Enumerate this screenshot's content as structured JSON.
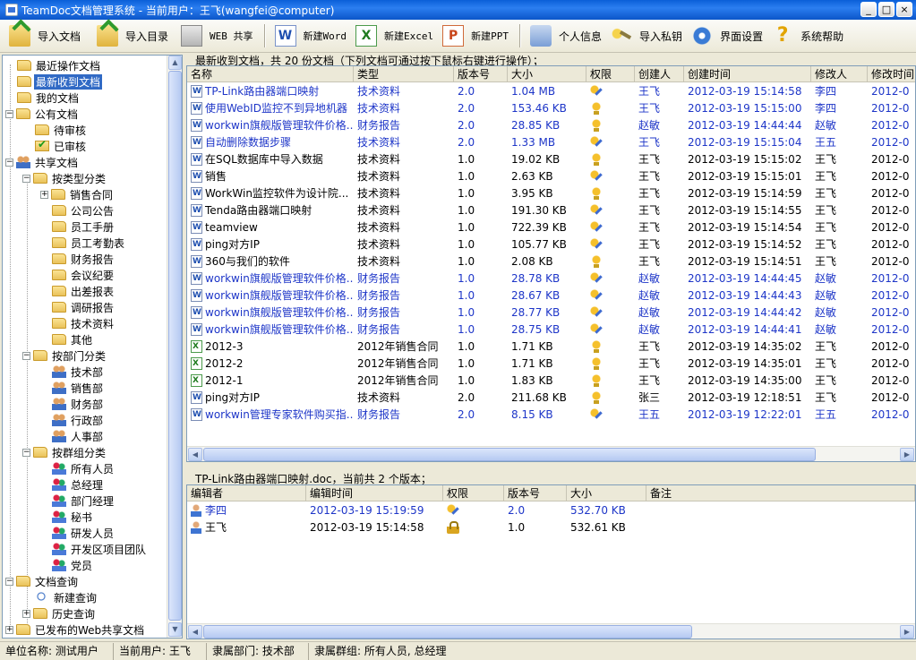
{
  "window": {
    "title": "TeamDoc文档管理系统 - 当前用户：王飞(wangfei@computer)",
    "buttons": [
      "_",
      "□",
      "×"
    ]
  },
  "toolbar": {
    "import_doc": "导入文档",
    "import_dir": "导入目录",
    "web_share": "WEB 共享",
    "new_word": "新建Word",
    "new_excel": "新建Excel",
    "new_ppt": "新建PPT",
    "personal_info": "个人信息",
    "import_key": "导入私钥",
    "ui_settings": "界面设置",
    "help": "系统帮助",
    "icons": {
      "import_doc": "import-folder-icon",
      "word": "word-icon",
      "excel": "excel-icon",
      "ppt": "ppt-icon"
    }
  },
  "tree": {
    "recent_ops": "最近操作文档",
    "recent_received": "最新收到文档",
    "my_docs": "我的文档",
    "public_docs": "公有文档",
    "pending_review": "待审核",
    "reviewed": "已审核",
    "shared_docs": "共享文档",
    "by_type": "按类型分类",
    "types": [
      "销售合同",
      "公司公告",
      "员工手册",
      "员工考勤表",
      "财务报告",
      "会议纪要",
      "出差报表",
      "调研报告",
      "技术资料",
      "其他"
    ],
    "by_dept": "按部门分类",
    "depts": [
      "技术部",
      "销售部",
      "财务部",
      "行政部",
      "人事部"
    ],
    "by_group": "按群组分类",
    "groups": [
      "所有人员",
      "总经理",
      "部门经理",
      "秘书",
      "研发人员",
      "开发区项目团队",
      "党员"
    ],
    "doc_query": "文档查询",
    "new_query": "新建查询",
    "history_query": "历史查询",
    "published_web": "已发布的Web共享文档"
  },
  "docs_panel": {
    "caption": "最新收到文档，共 20 份文档（下列文档可通过按下鼠标右键进行操作）；",
    "columns": [
      "名称",
      "类型",
      "版本号",
      "大小",
      "权限",
      "创建人",
      "创建时间",
      "修改人",
      "修改时间"
    ],
    "rows": [
      {
        "name": "TP-Link路由器端口映射",
        "type": "技术资料",
        "version": "2.0",
        "size": "1.04 MB",
        "perm": "edit",
        "creator": "王飞",
        "created": "2012-03-19 15:14:58",
        "modifier": "李四",
        "modified": "2012-0",
        "blue": true,
        "icon": "doc"
      },
      {
        "name": "使用WebID监控不到异地机器",
        "type": "技术资料",
        "version": "2.0",
        "size": "153.46 KB",
        "perm": "view",
        "creator": "王飞",
        "created": "2012-03-19 15:15:00",
        "modifier": "李四",
        "modified": "2012-0",
        "blue": true,
        "icon": "doc"
      },
      {
        "name": "workwin旗舰版管理软件价格...",
        "type": "财务报告",
        "version": "2.0",
        "size": "28.85 KB",
        "perm": "view",
        "creator": "赵敏",
        "created": "2012-03-19 14:44:44",
        "modifier": "赵敏",
        "modified": "2012-0",
        "blue": true,
        "icon": "doc"
      },
      {
        "name": "自动删除数据步骤",
        "type": "技术资料",
        "version": "2.0",
        "size": "1.33 MB",
        "perm": "edit",
        "creator": "王飞",
        "created": "2012-03-19 15:15:04",
        "modifier": "王五",
        "modified": "2012-0",
        "blue": true,
        "icon": "doc"
      },
      {
        "name": "在SQL数据库中导入数据",
        "type": "技术资料",
        "version": "1.0",
        "size": "19.02 KB",
        "perm": "view",
        "creator": "王飞",
        "created": "2012-03-19 15:15:02",
        "modifier": "王飞",
        "modified": "2012-0",
        "blue": false,
        "icon": "doc"
      },
      {
        "name": "销售",
        "type": "技术资料",
        "version": "1.0",
        "size": "2.63 KB",
        "perm": "edit",
        "creator": "王飞",
        "created": "2012-03-19 15:15:01",
        "modifier": "王飞",
        "modified": "2012-0",
        "blue": false,
        "icon": "doc"
      },
      {
        "name": "WorkWin监控软件为设计院...",
        "type": "技术资料",
        "version": "1.0",
        "size": "3.95 KB",
        "perm": "view",
        "creator": "王飞",
        "created": "2012-03-19 15:14:59",
        "modifier": "王飞",
        "modified": "2012-0",
        "blue": false,
        "icon": "doc"
      },
      {
        "name": "Tenda路由器端口映射",
        "type": "技术资料",
        "version": "1.0",
        "size": "191.30 KB",
        "perm": "edit",
        "creator": "王飞",
        "created": "2012-03-19 15:14:55",
        "modifier": "王飞",
        "modified": "2012-0",
        "blue": false,
        "icon": "doc"
      },
      {
        "name": "teamview",
        "type": "技术资料",
        "version": "1.0",
        "size": "722.39 KB",
        "perm": "edit",
        "creator": "王飞",
        "created": "2012-03-19 15:14:54",
        "modifier": "王飞",
        "modified": "2012-0",
        "blue": false,
        "icon": "doc"
      },
      {
        "name": "ping对方IP",
        "type": "技术资料",
        "version": "1.0",
        "size": "105.77 KB",
        "perm": "edit",
        "creator": "王飞",
        "created": "2012-03-19 15:14:52",
        "modifier": "王飞",
        "modified": "2012-0",
        "blue": false,
        "icon": "doc"
      },
      {
        "name": "360与我们的软件",
        "type": "技术资料",
        "version": "1.0",
        "size": "2.08 KB",
        "perm": "view",
        "creator": "王飞",
        "created": "2012-03-19 15:14:51",
        "modifier": "王飞",
        "modified": "2012-0",
        "blue": false,
        "icon": "doc"
      },
      {
        "name": "workwin旗舰版管理软件价格...",
        "type": "财务报告",
        "version": "1.0",
        "size": "28.78 KB",
        "perm": "edit",
        "creator": "赵敏",
        "created": "2012-03-19 14:44:45",
        "modifier": "赵敏",
        "modified": "2012-0",
        "blue": true,
        "icon": "doc"
      },
      {
        "name": "workwin旗舰版管理软件价格...",
        "type": "财务报告",
        "version": "1.0",
        "size": "28.67 KB",
        "perm": "edit",
        "creator": "赵敏",
        "created": "2012-03-19 14:44:43",
        "modifier": "赵敏",
        "modified": "2012-0",
        "blue": true,
        "icon": "doc"
      },
      {
        "name": "workwin旗舰版管理软件价格...",
        "type": "财务报告",
        "version": "1.0",
        "size": "28.77 KB",
        "perm": "edit",
        "creator": "赵敏",
        "created": "2012-03-19 14:44:42",
        "modifier": "赵敏",
        "modified": "2012-0",
        "blue": true,
        "icon": "doc"
      },
      {
        "name": "workwin旗舰版管理软件价格...",
        "type": "财务报告",
        "version": "1.0",
        "size": "28.75 KB",
        "perm": "edit",
        "creator": "赵敏",
        "created": "2012-03-19 14:44:41",
        "modifier": "赵敏",
        "modified": "2012-0",
        "blue": true,
        "icon": "doc"
      },
      {
        "name": "2012-3",
        "type": "2012年销售合同",
        "version": "1.0",
        "size": "1.71 KB",
        "perm": "view",
        "creator": "王飞",
        "created": "2012-03-19 14:35:02",
        "modifier": "王飞",
        "modified": "2012-0",
        "blue": false,
        "icon": "xls"
      },
      {
        "name": "2012-2",
        "type": "2012年销售合同",
        "version": "1.0",
        "size": "1.71 KB",
        "perm": "view",
        "creator": "王飞",
        "created": "2012-03-19 14:35:01",
        "modifier": "王飞",
        "modified": "2012-0",
        "blue": false,
        "icon": "xls"
      },
      {
        "name": "2012-1",
        "type": "2012年销售合同",
        "version": "1.0",
        "size": "1.83 KB",
        "perm": "view",
        "creator": "王飞",
        "created": "2012-03-19 14:35:00",
        "modifier": "王飞",
        "modified": "2012-0",
        "blue": false,
        "icon": "xls"
      },
      {
        "name": "ping对方IP",
        "type": "技术资料",
        "version": "2.0",
        "size": "211.68 KB",
        "perm": "view",
        "creator": "张三",
        "created": "2012-03-19 12:18:51",
        "modifier": "王飞",
        "modified": "2012-0",
        "blue": false,
        "icon": "doc"
      },
      {
        "name": "workwin管理专家软件购买指...",
        "type": "财务报告",
        "version": "2.0",
        "size": "8.15 KB",
        "perm": "edit",
        "creator": "王五",
        "created": "2012-03-19 12:22:01",
        "modifier": "王五",
        "modified": "2012-0",
        "blue": true,
        "icon": "doc"
      }
    ]
  },
  "versions_panel": {
    "caption": "TP-Link路由器端口映射.doc，当前共 2 个版本；",
    "columns": [
      "编辑者",
      "编辑时间",
      "权限",
      "版本号",
      "大小",
      "备注"
    ],
    "rows": [
      {
        "editor": "李四",
        "time": "2012-03-19 15:19:59",
        "perm": "edit",
        "version": "2.0",
        "size": "532.70 KB",
        "note": "",
        "blue": true
      },
      {
        "editor": "王飞",
        "time": "2012-03-19 15:14:58",
        "perm": "lock",
        "version": "1.0",
        "size": "532.61 KB",
        "note": "",
        "blue": false
      }
    ]
  },
  "statusbar": {
    "unit": "单位名称: 测试用户",
    "user": "当前用户: 王飞",
    "dept": "隶属部门: 技术部",
    "group": "隶属群组: 所有人员, 总经理"
  },
  "colors": {
    "selection": "#316ac5",
    "link_text": "#1e36c8",
    "titlebar": "#0a5fd8"
  }
}
